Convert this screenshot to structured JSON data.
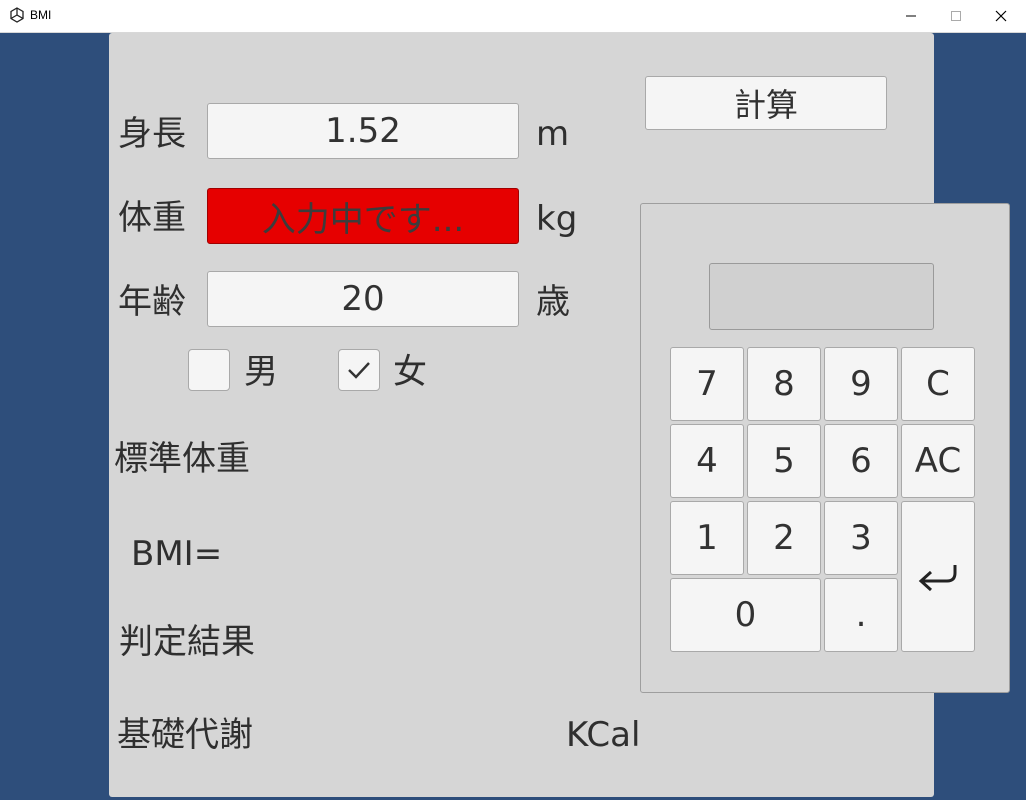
{
  "window": {
    "title": "BMI",
    "icon": "unity-icon"
  },
  "form": {
    "height": {
      "label": "身長",
      "value": "1.52",
      "unit": "m"
    },
    "weight": {
      "label": "体重",
      "value": "入力中です...",
      "unit": "kg",
      "state_color": "#e60000"
    },
    "age": {
      "label": "年齢",
      "value": "20",
      "unit": "歳"
    },
    "gender": {
      "male": {
        "label": "男",
        "checked": false
      },
      "female": {
        "label": "女",
        "checked": true
      }
    }
  },
  "results": {
    "standard_weight_label": "標準体重",
    "bmi_label": "BMI=",
    "judgement_label": "判定結果",
    "bmr_label": "基礎代謝",
    "bmr_unit": "KCal"
  },
  "calculate_button": "計算",
  "keypad": {
    "display": "",
    "keys": [
      "7",
      "8",
      "9",
      "C",
      "4",
      "5",
      "6",
      "AC",
      "1",
      "2",
      "3",
      "0",
      "."
    ],
    "enter_icon": "enter-return-icon"
  },
  "colors": {
    "background": "#2e4e7b",
    "panel": "#d6d6d6",
    "active_field": "#e60000"
  }
}
